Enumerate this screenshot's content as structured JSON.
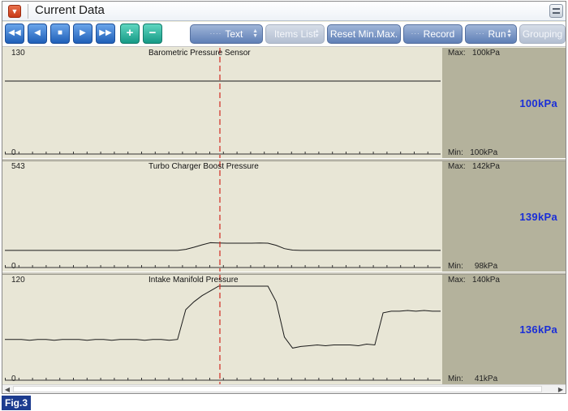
{
  "window": {
    "title": "Current Data",
    "figure_label": "Fig.3"
  },
  "toolbar": {
    "nav_buttons": [
      {
        "name": "first-button",
        "glyph": "◀◀"
      },
      {
        "name": "prev-button",
        "glyph": "◀"
      },
      {
        "name": "stop-button",
        "glyph": "■"
      },
      {
        "name": "next-button",
        "glyph": "▶"
      },
      {
        "name": "last-button",
        "glyph": "▶▶"
      }
    ],
    "add_glyph": "+",
    "remove_glyph": "−",
    "text_label": "Text",
    "items_list_label": "Items List",
    "reset_label": "Reset Min.Max.",
    "record_label": "Record",
    "run_label": "Run",
    "grouping_label": "Grouping"
  },
  "units": "kPa",
  "chart_data": [
    {
      "type": "line",
      "title": "Barometric Pressure Sensor",
      "ylim": [
        0,
        130
      ],
      "y_max_label": "130",
      "y_min_label": "0",
      "series": [
        {
          "values": [
            100,
            100,
            100,
            100,
            100,
            100,
            100,
            100,
            100,
            100,
            100,
            100,
            100,
            100,
            100,
            100,
            100,
            100,
            100,
            100,
            100,
            100,
            100,
            100,
            100,
            100,
            100,
            100,
            100,
            100,
            100,
            100,
            100,
            100,
            100,
            100,
            100,
            100,
            100,
            100,
            100,
            100,
            100,
            100,
            100,
            100,
            100,
            100,
            100,
            100,
            100,
            100,
            100,
            100
          ]
        }
      ],
      "max_label": "Max:",
      "max_value": "100kPa",
      "min_label": "Min:",
      "min_value": "100kPa",
      "current_value": "100kPa"
    },
    {
      "type": "line",
      "title": "Turbo Charger Boost Pressure",
      "ylim": [
        0,
        543
      ],
      "y_max_label": "543",
      "y_min_label": "0",
      "series": [
        {
          "values": [
            98,
            98,
            98,
            98,
            98,
            98,
            98,
            98,
            98,
            98,
            98,
            98,
            98,
            98,
            98,
            98,
            98,
            98,
            98,
            98,
            98,
            98,
            104,
            116,
            130,
            142,
            140,
            139,
            139,
            139,
            139,
            140,
            139,
            127,
            108,
            100,
            98,
            98,
            98,
            98,
            98,
            98,
            98,
            98,
            98,
            98,
            98,
            98,
            98,
            98,
            98,
            98,
            98,
            98
          ]
        }
      ],
      "max_label": "Max:",
      "max_value": "142kPa",
      "min_label": "Min:",
      "min_value": "98kPa",
      "current_value": "139kPa"
    },
    {
      "type": "line",
      "title": "Intake Manifold Pressure",
      "ylim": [
        0,
        120
      ],
      "y_max_label": "120",
      "y_min_label": "0",
      "series": [
        {
          "values": [
            52,
            52,
            52,
            51,
            52,
            52,
            51,
            52,
            52,
            52,
            51,
            52,
            52,
            51,
            52,
            52,
            52,
            51,
            52,
            52,
            51,
            52,
            90,
            100,
            108,
            114,
            120,
            120,
            120,
            120,
            120,
            120,
            120,
            100,
            55,
            41,
            43,
            44,
            45,
            44,
            45,
            45,
            45,
            44,
            46,
            45,
            86,
            88,
            88,
            89,
            88,
            89,
            88,
            88
          ]
        }
      ],
      "max_label": "Max:",
      "max_value": "140kPa",
      "min_label": "Min:",
      "min_value": "41kPa",
      "current_value": "136kPa"
    }
  ]
}
